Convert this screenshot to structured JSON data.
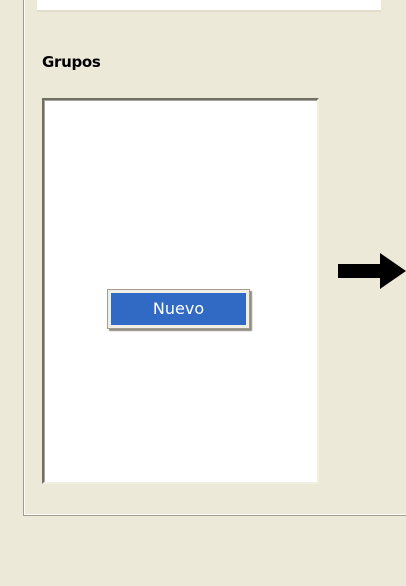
{
  "group": {
    "title": "Grupos"
  },
  "context_menu": {
    "items": [
      {
        "label": "Nuevo"
      }
    ],
    "highlight_color": "#316ac5"
  },
  "icons": {
    "arrow": "arrow-right-icon"
  },
  "colors": {
    "background": "#ece9d8",
    "listbox": "#ffffff"
  }
}
